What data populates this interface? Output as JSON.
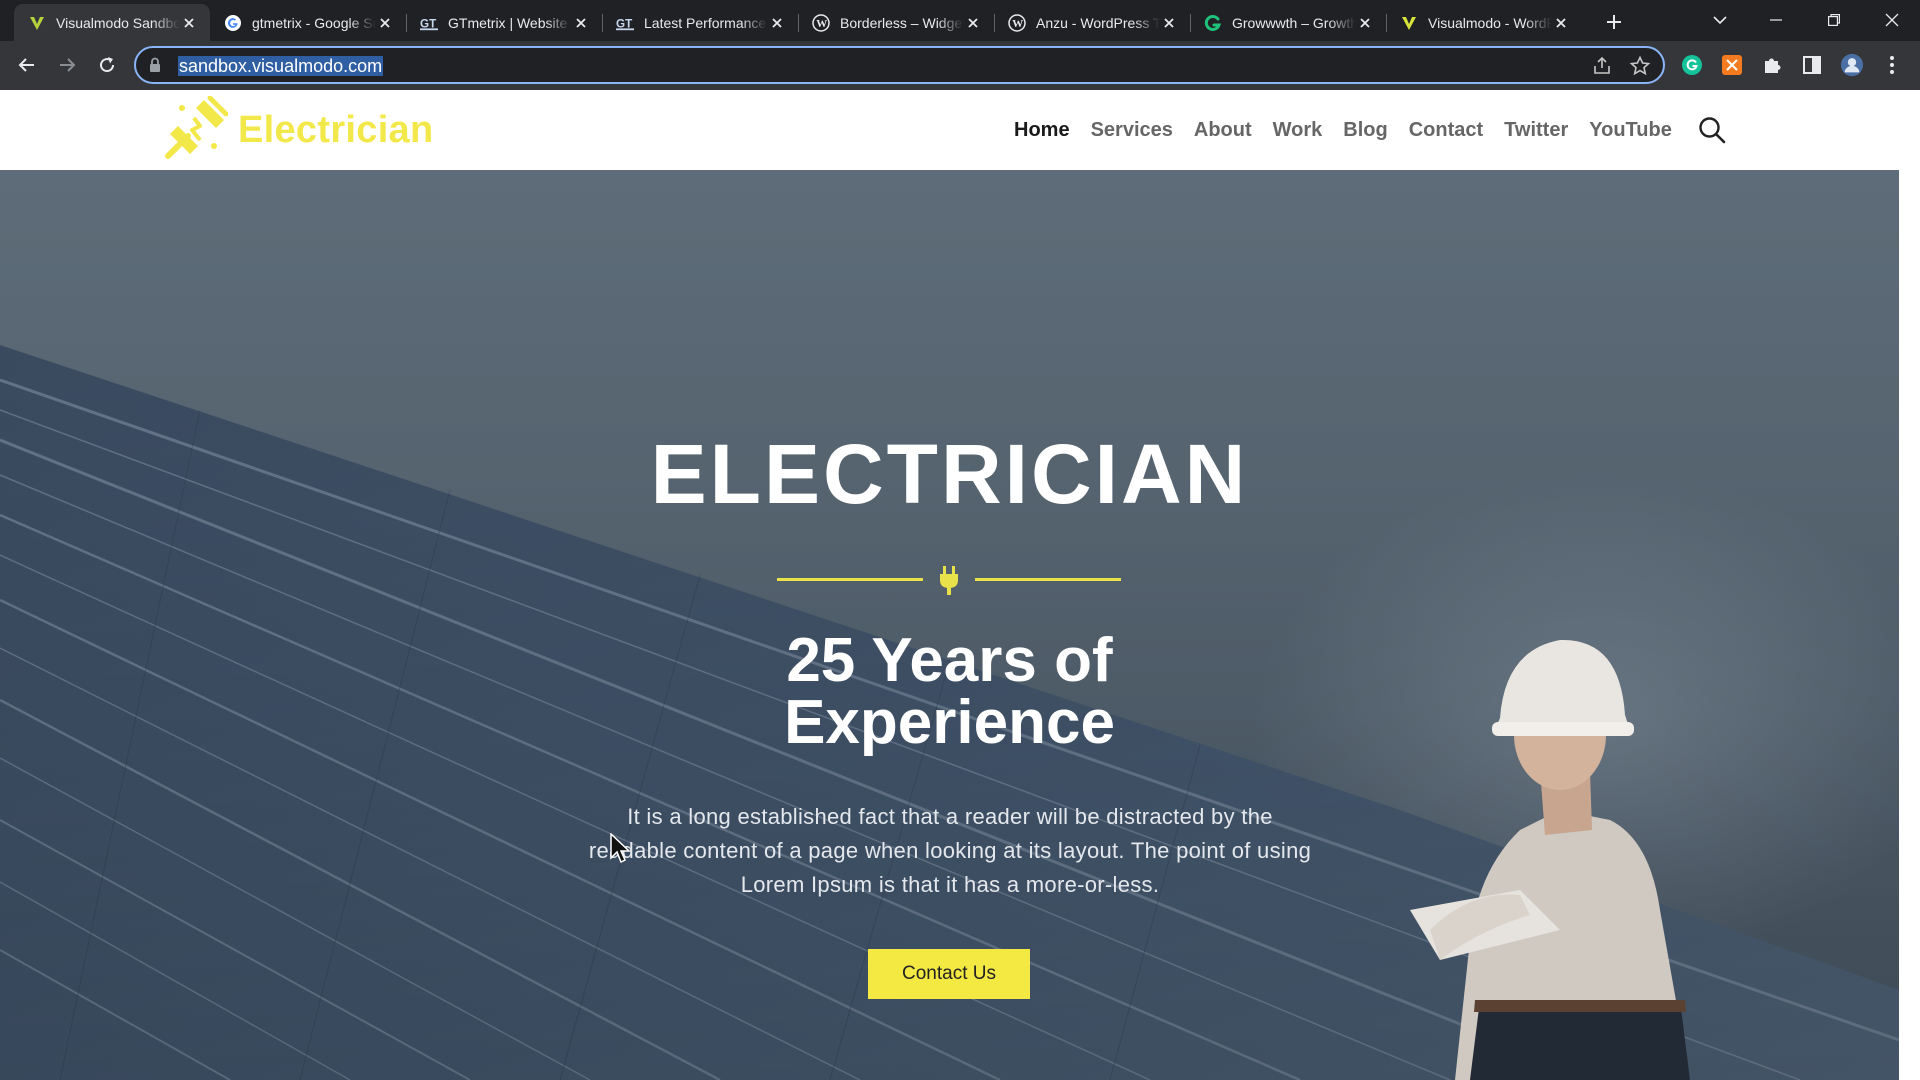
{
  "browser": {
    "tabs": [
      {
        "title": "Visualmodo Sandbox",
        "favicon": "visualmodo-v-icon",
        "active": true
      },
      {
        "title": "gtmetrix - Google Search",
        "favicon": "google-icon",
        "active": false
      },
      {
        "title": "GTmetrix | Website Speed",
        "favicon": "gtmetrix-icon",
        "active": false
      },
      {
        "title": "Latest Performance Report",
        "favicon": "gtmetrix-icon",
        "active": false
      },
      {
        "title": "Borderless – Widgets",
        "favicon": "wordpress-icon",
        "active": false
      },
      {
        "title": "Anzu - WordPress Theme",
        "favicon": "wordpress-icon",
        "active": false
      },
      {
        "title": "Growwwth – Growth",
        "favicon": "growwwth-icon",
        "active": false
      },
      {
        "title": "Visualmodo - WordPress",
        "favicon": "visualmodo-v-icon",
        "active": false
      }
    ],
    "url": "sandbox.visualmodo.com"
  },
  "site": {
    "logo_text": "Electrician",
    "nav": [
      {
        "label": "Home",
        "current": true
      },
      {
        "label": "Services",
        "current": false
      },
      {
        "label": "About",
        "current": false
      },
      {
        "label": "Work",
        "current": false
      },
      {
        "label": "Blog",
        "current": false
      },
      {
        "label": "Contact",
        "current": false
      },
      {
        "label": "Twitter",
        "current": false
      },
      {
        "label": "YouTube",
        "current": false
      }
    ]
  },
  "hero": {
    "title": "ELECTRICIAN",
    "subtitle_line1": "25 Years of",
    "subtitle_line2": "Experience",
    "text": "It is a long established fact that a reader will be distracted by the readable content of a page when looking at its layout. The point of using Lorem Ipsum is that it has a more-or-less.",
    "cta_label": "Contact Us"
  },
  "colors": {
    "accent_yellow": "#f4e943",
    "logo_yellow": "#f3e84a",
    "chrome_dark": "#202124",
    "chrome_toolbar": "#35363a",
    "omnibox_focus": "#8ab4f8"
  }
}
